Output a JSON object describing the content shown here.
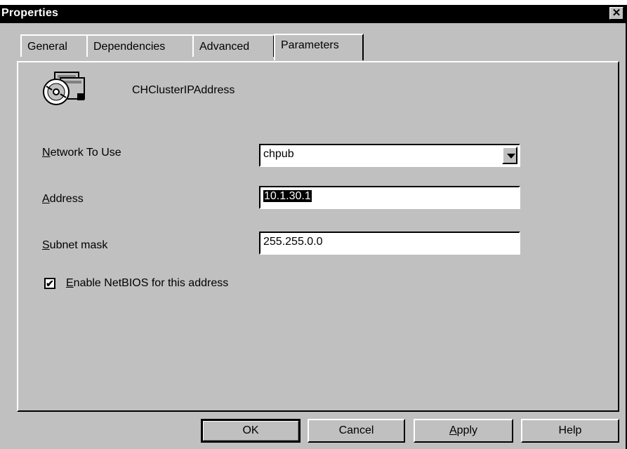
{
  "window": {
    "title": "Properties"
  },
  "close_glyph": "✕",
  "tabs": [
    {
      "label": "General",
      "active": false
    },
    {
      "label": "Dependencies",
      "active": false
    },
    {
      "label": "Advanced",
      "active": false
    },
    {
      "label": "Parameters",
      "active": true
    }
  ],
  "resource": {
    "name": "CHClusterIPAddress",
    "icon": "cluster-disk-icon"
  },
  "form": {
    "network": {
      "label_hotkey": "N",
      "label_rest": "etwork To Use",
      "value": "chpub"
    },
    "address": {
      "label_hotkey": "A",
      "label_rest": "ddress",
      "value": "10.1.30.1"
    },
    "subnet": {
      "label_hotkey": "S",
      "label_rest": "ubnet mask",
      "value": "255.255.0.0"
    },
    "netbios": {
      "checked": true,
      "check_glyph": "✔",
      "label_hotkey": "E",
      "label_rest": "nable NetBIOS for this address"
    }
  },
  "buttons": {
    "ok": "OK",
    "cancel": "Cancel",
    "apply_hotkey": "A",
    "apply_rest": "pply",
    "help": "Help"
  }
}
